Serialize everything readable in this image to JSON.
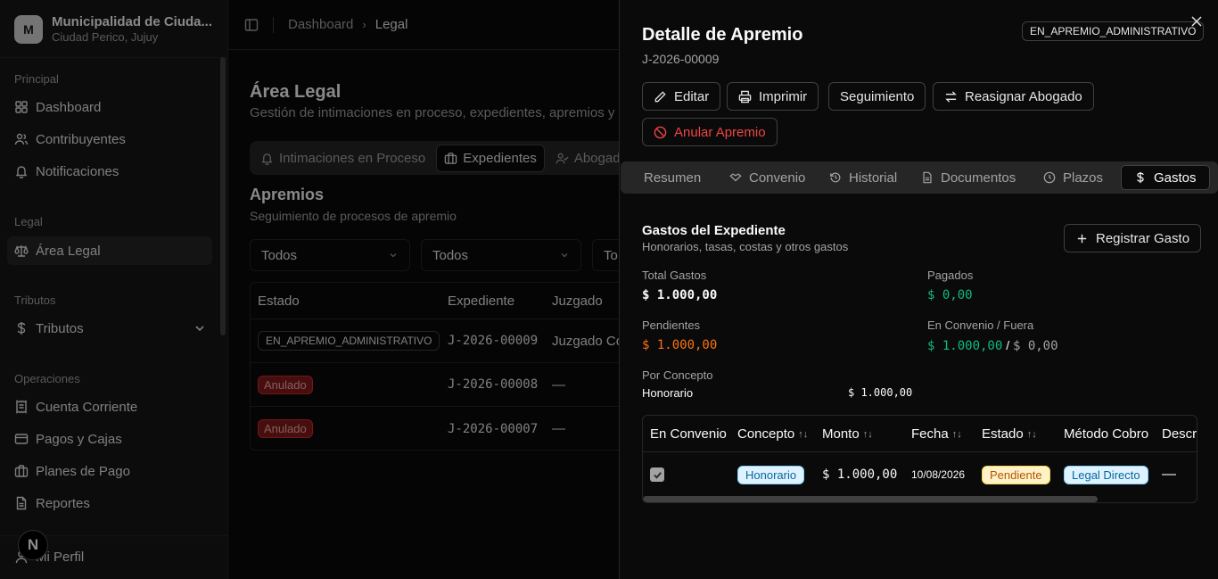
{
  "sidebar": {
    "org_initial": "M",
    "org_name": "Municipalidad de Ciuda...",
    "org_location": "Ciudad Perico, Jujuy",
    "groups": {
      "principal": "Principal",
      "legal": "Legal",
      "tributos": "Tributos",
      "operaciones": "Operaciones"
    },
    "items": {
      "dashboard": "Dashboard",
      "contribuyentes": "Contribuyentes",
      "notificaciones": "Notificaciones",
      "area_legal": "Área Legal",
      "tributos": "Tributos",
      "cuenta_corriente": "Cuenta Corriente",
      "pagos_cajas": "Pagos y Cajas",
      "planes_pago": "Planes de Pago",
      "reportes": "Reportes",
      "mi_perfil": "Mi Perfil"
    },
    "badge": "N"
  },
  "topbar": {
    "breadcrumb_root": "Dashboard",
    "breadcrumb_current": "Legal"
  },
  "main": {
    "title": "Área Legal",
    "subtitle": "Gestión de intimaciones en proceso, expedientes, apremios y a",
    "tabs": {
      "intimaciones": "Intimaciones en Proceso",
      "expedientes": "Expedientes",
      "abogados": "Abogado"
    },
    "section_title": "Apremios",
    "section_sub": "Seguimiento de procesos de apremio",
    "filters": [
      "Todos",
      "Todos",
      "To"
    ],
    "table": {
      "headers": {
        "estado": "Estado",
        "expediente": "Expediente",
        "juzgado": "Juzgado"
      },
      "rows": [
        {
          "estado": "EN_APREMIO_ADMINISTRATIVO",
          "expediente": "J-2026-00009",
          "juzgado": "Juzgado Co"
        },
        {
          "estado": "Anulado",
          "expediente": "J-2026-00008",
          "juzgado": "—"
        },
        {
          "estado": "Anulado",
          "expediente": "J-2026-00007",
          "juzgado": "—"
        }
      ]
    }
  },
  "drawer": {
    "title": "Detalle de Apremio",
    "id": "J-2026-00009",
    "status": "EN_APREMIO_ADMINISTRATIVO",
    "actions": {
      "editar": "Editar",
      "imprimir": "Imprimir",
      "seguimiento": "Seguimiento",
      "reasignar": "Reasignar Abogado",
      "anular": "Anular Apremio"
    },
    "tabs": {
      "resumen": "Resumen",
      "convenio": "Convenio",
      "historial": "Historial",
      "documentos": "Documentos",
      "plazos": "Plazos",
      "gastos": "Gastos"
    },
    "gastos": {
      "title": "Gastos del Expediente",
      "subtitle": "Honorarios, tasas, costas y otros gastos",
      "register_button": "Registrar Gasto",
      "total_label": "Total Gastos",
      "total_value": "$ 1.000,00",
      "pagados_label": "Pagados",
      "pagados_value": "$ 0,00",
      "pendientes_label": "Pendientes",
      "pendientes_value": "$ 1.000,00",
      "convenio_label": "En Convenio / Fuera",
      "convenio_value": "$ 1.000,00",
      "convenio_sep": "/",
      "fuera_value": "$ 0,00",
      "por_concepto_label": "Por Concepto",
      "concepto_name": "Honorario",
      "concepto_value": "$ 1.000,00",
      "table": {
        "headers": {
          "en_convenio": "En Convenio",
          "concepto": "Concepto",
          "monto": "Monto",
          "fecha": "Fecha",
          "estado": "Estado",
          "metodo": "Método Cobro",
          "descr": "Descr"
        },
        "row": {
          "concepto": "Honorario",
          "monto": "$ 1.000,00",
          "fecha": "10/08/2026",
          "estado": "Pendiente",
          "metodo": "Legal Directo",
          "descr": "—"
        }
      }
    }
  },
  "colors": {
    "green": "#10b981",
    "orange": "#f97316",
    "danger": "#ef4444"
  }
}
